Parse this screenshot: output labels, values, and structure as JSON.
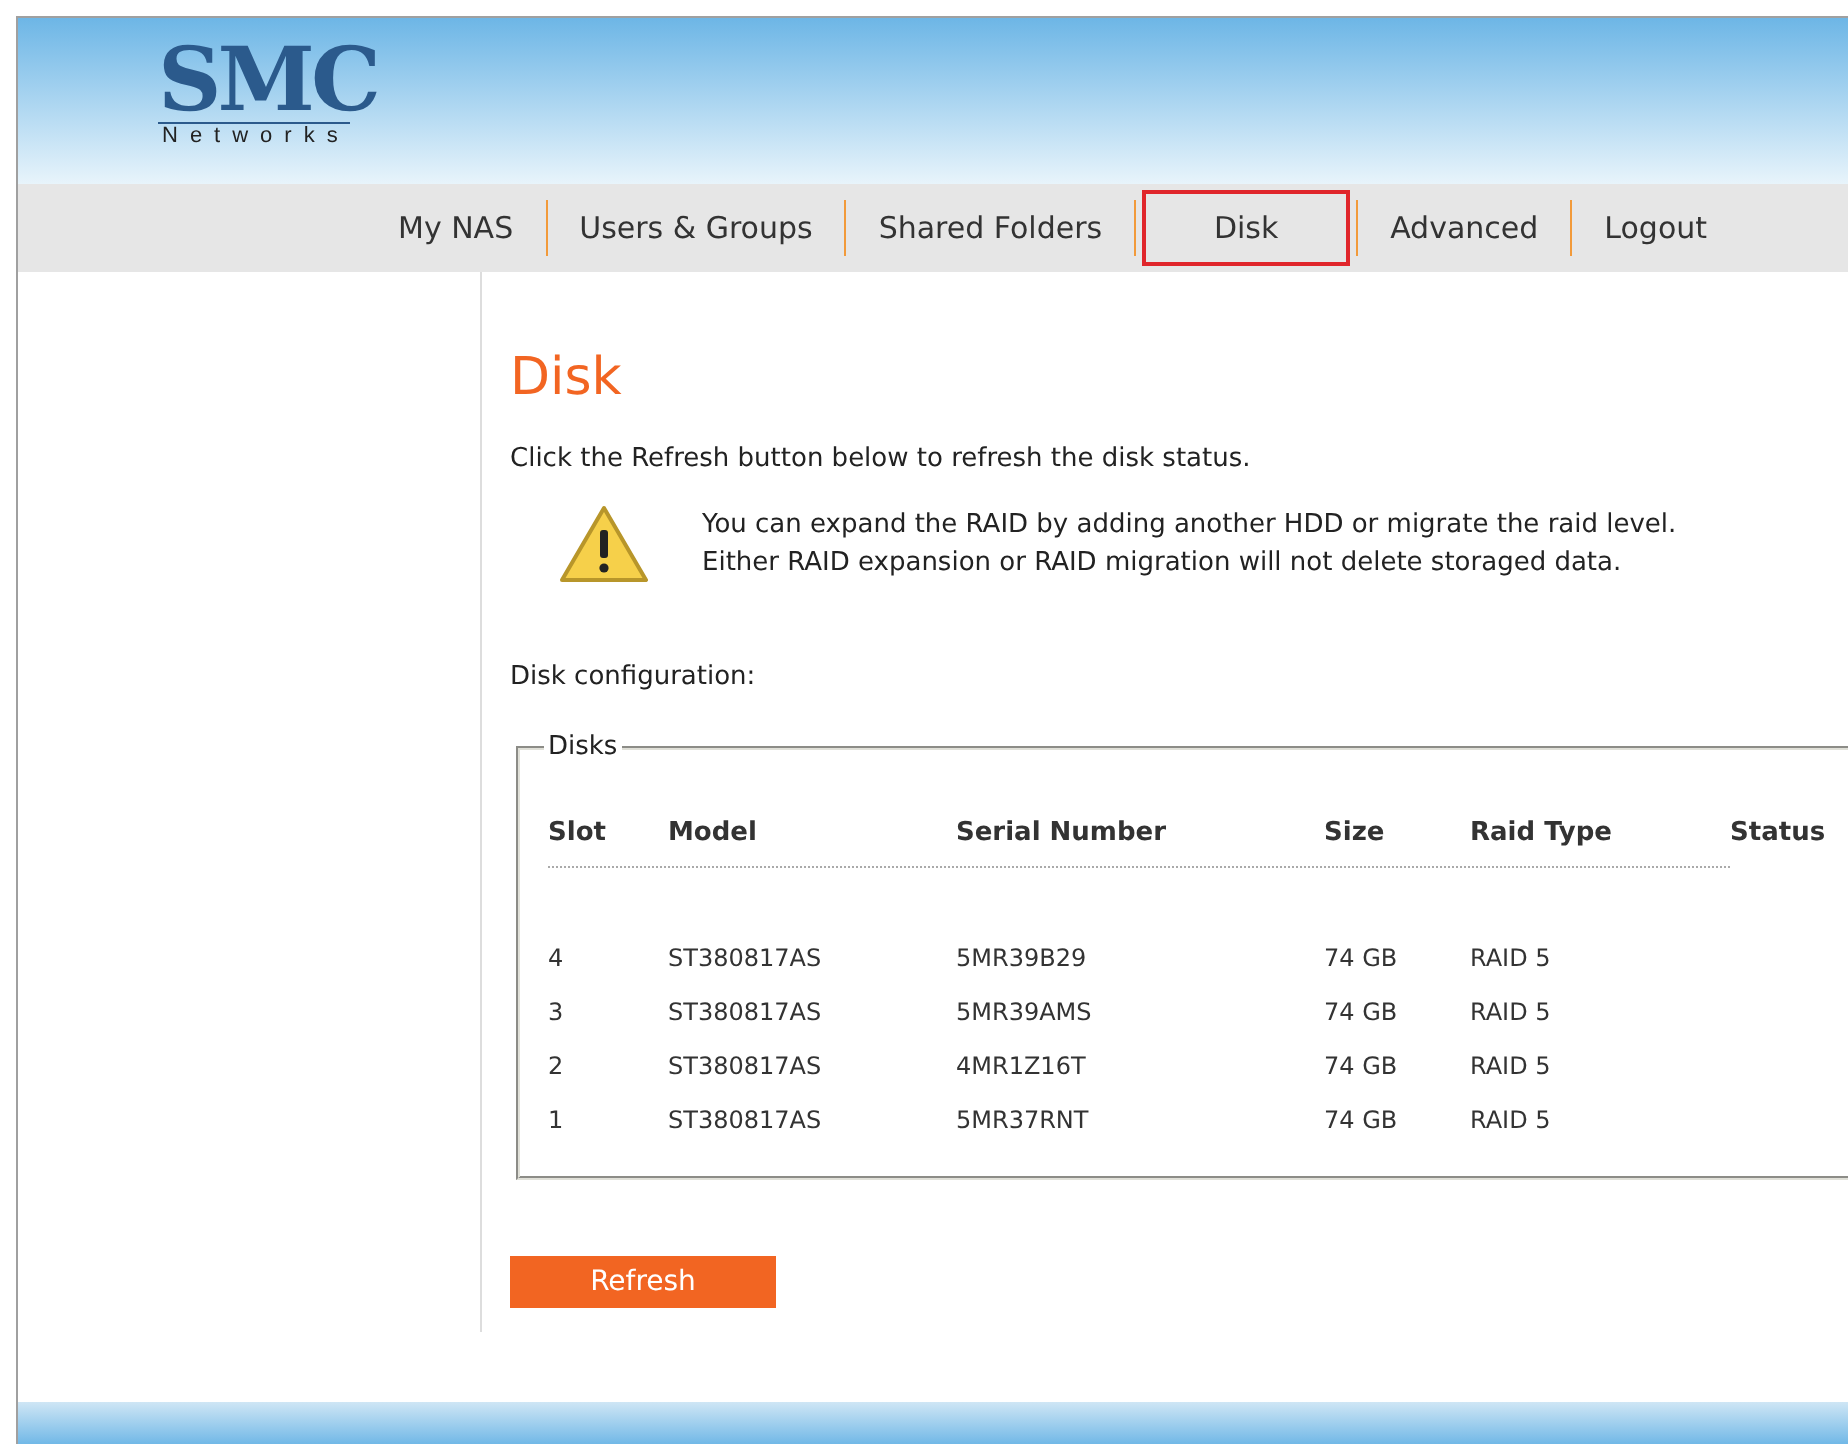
{
  "logo": {
    "brand": "SMC",
    "tagline": "Networks"
  },
  "nav": [
    {
      "label": "My NAS",
      "selected": false
    },
    {
      "label": "Users & Groups",
      "selected": false
    },
    {
      "label": "Shared Folders",
      "selected": false
    },
    {
      "label": "Disk",
      "selected": true
    },
    {
      "label": "Advanced",
      "selected": false
    },
    {
      "label": "Logout",
      "selected": false
    }
  ],
  "page": {
    "title": "Disk",
    "intro": "Click the Refresh button below to refresh the disk status.",
    "notice": [
      "You can expand the RAID by adding another HDD or migrate the raid level.",
      "Either RAID expansion or RAID migration will not delete storaged data."
    ],
    "config_label": "Disk configuration:"
  },
  "disks": {
    "legend": "Disks",
    "columns": [
      "Slot",
      "Model",
      "Serial Number",
      "Size",
      "Raid Type",
      "Status"
    ],
    "rows": [
      [
        "4",
        "ST380817AS",
        "5MR39B29",
        "74 GB",
        "RAID 5"
      ],
      [
        "3",
        "ST380817AS",
        "5MR39AMS",
        "74 GB",
        "RAID 5"
      ],
      [
        "2",
        "ST380817AS",
        "4MR1Z16T",
        "74 GB",
        "RAID 5"
      ],
      [
        "1",
        "ST380817AS",
        "5MR37RNT",
        "74 GB",
        "RAID 5"
      ]
    ]
  },
  "refresh_button": "Refresh"
}
